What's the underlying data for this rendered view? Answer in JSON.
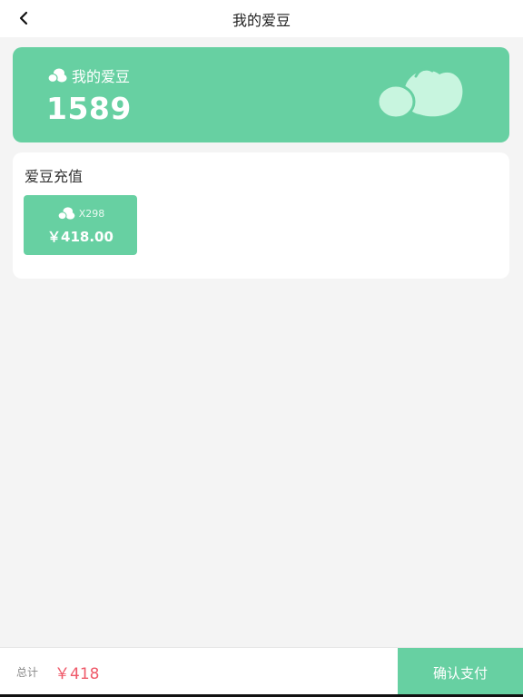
{
  "header": {
    "title": "我的爱豆",
    "back_icon": "chevron-left-icon"
  },
  "balance": {
    "label": "我的爱豆",
    "value": "1589",
    "icon": "bean-icon"
  },
  "recharge": {
    "title": "爱豆充值",
    "packages": [
      {
        "quantity": "X298",
        "price": "￥418.00",
        "selected": true
      }
    ]
  },
  "footer": {
    "total_label": "总计",
    "total_amount": "￥418",
    "confirm_label": "确认支付"
  },
  "colors": {
    "accent": "#67d0a2",
    "price_red": "#ef5a6a",
    "background": "#f4f4f4"
  }
}
